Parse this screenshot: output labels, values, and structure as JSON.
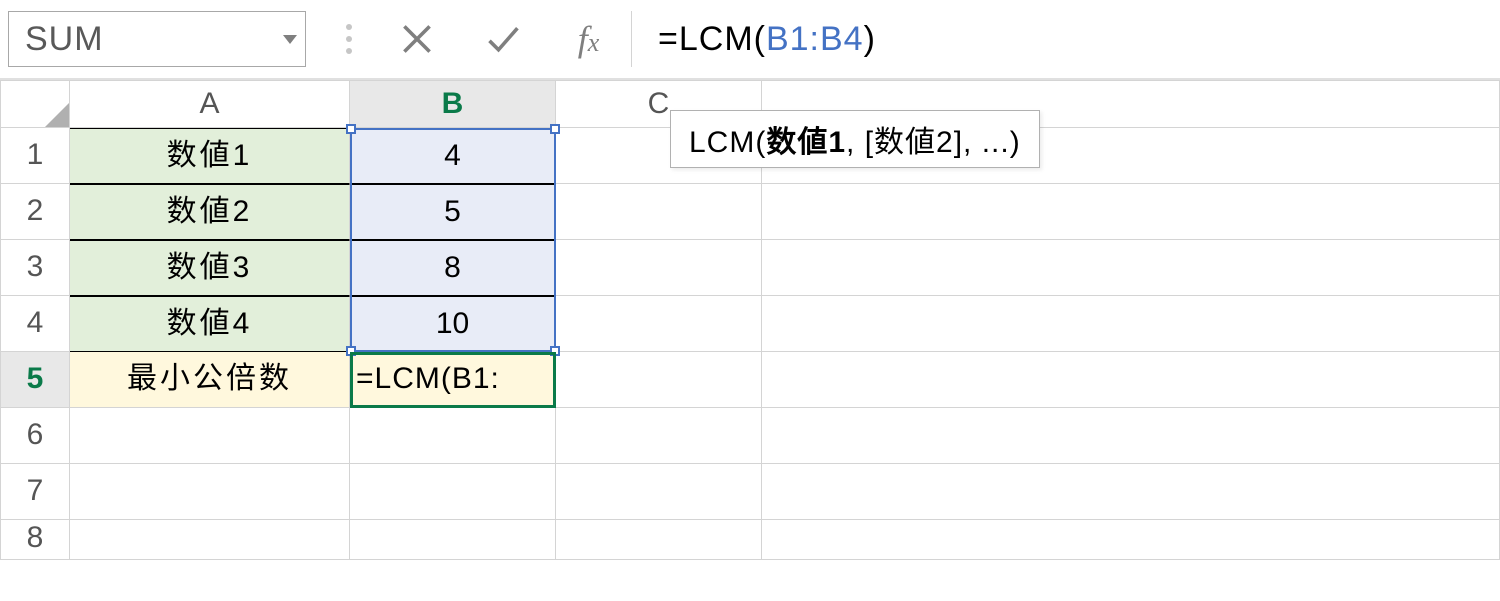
{
  "name_box": "SUM",
  "formula": {
    "prefix": "=LCM(",
    "ref": "B1:B4",
    "suffix": ")"
  },
  "tooltip": {
    "fn": "LCM(",
    "arg1": "数値1",
    "rest": ", [数値2], ...)"
  },
  "columns": [
    "A",
    "B",
    "C"
  ],
  "rows": [
    "1",
    "2",
    "3",
    "4",
    "5",
    "6",
    "7",
    "8"
  ],
  "cells": {
    "A1": "数値1",
    "B1": "4",
    "A2": "数値2",
    "B2": "5",
    "A3": "数値3",
    "B3": "8",
    "A4": "数値4",
    "B4": "10",
    "A5": "最小公倍数",
    "B5": "=LCM(B1:"
  },
  "active_row": "5",
  "active_col": "B"
}
